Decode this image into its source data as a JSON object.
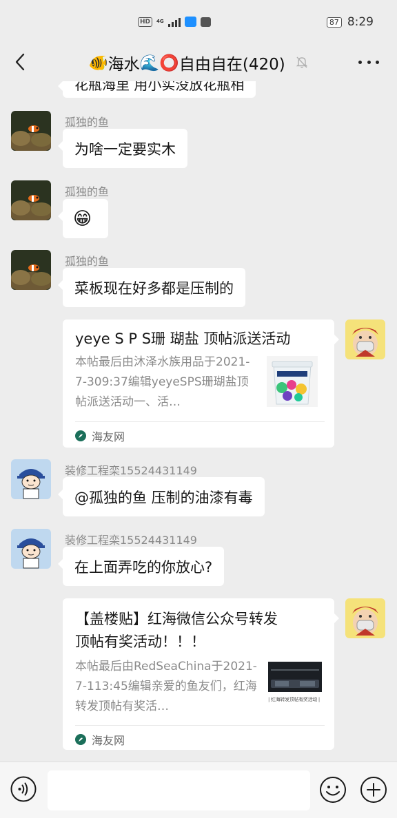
{
  "status_bar": {
    "hd": "HD",
    "network": "4G",
    "battery": "87",
    "time": "8:29"
  },
  "header": {
    "fish_emoji": "🐠",
    "title_part1": "海水",
    "wave_emoji": "🌊",
    "circle_emoji": "⭕",
    "title_part2": "自由自在(420)"
  },
  "messages": {
    "partial_text": "花瓶海里   用小实没放花瓶相",
    "m1": {
      "sender": "孤独的鱼",
      "text": "为啥一定要实木"
    },
    "m2": {
      "sender": "孤独的鱼",
      "text": "😁"
    },
    "m3": {
      "sender": "孤独的鱼",
      "text": "菜板现在好多都是压制的"
    },
    "card1": {
      "title": "yeye S P S珊 瑚盐 顶帖派送活动",
      "desc": "本帖最后由沐泽水族用品于2021-7-309:37编辑yeyeSPS珊瑚盐顶帖派送活动一、活…",
      "source": "海友网"
    },
    "m4": {
      "sender": "装修工程栾15524431149",
      "text": "@孤独的鱼  压制的油漆有毒"
    },
    "m5": {
      "sender": "装修工程栾15524431149",
      "text": "在上面弄吃的你放心?"
    },
    "card2": {
      "title_line1": "【盖楼贴】红海微信公众号转发",
      "title_line2": "顶帖有奖活动！！！",
      "desc": "本帖最后由RedSeaChina于2021-7-113:45编辑亲爱的鱼友们，红海转发顶帖有奖活…",
      "thumb_caption": "| 红海转发顶帖有奖活动 |",
      "source": "海友网"
    }
  },
  "icons": {
    "back": "back-arrow-icon",
    "mute": "bell-muted-icon",
    "more": "more-dots-icon",
    "voice": "voice-icon",
    "emoji": "emoji-icon",
    "plus": "plus-icon"
  },
  "colors": {
    "background": "#ededed",
    "bubble": "#ffffff",
    "meta_text": "#8a8a8a"
  }
}
